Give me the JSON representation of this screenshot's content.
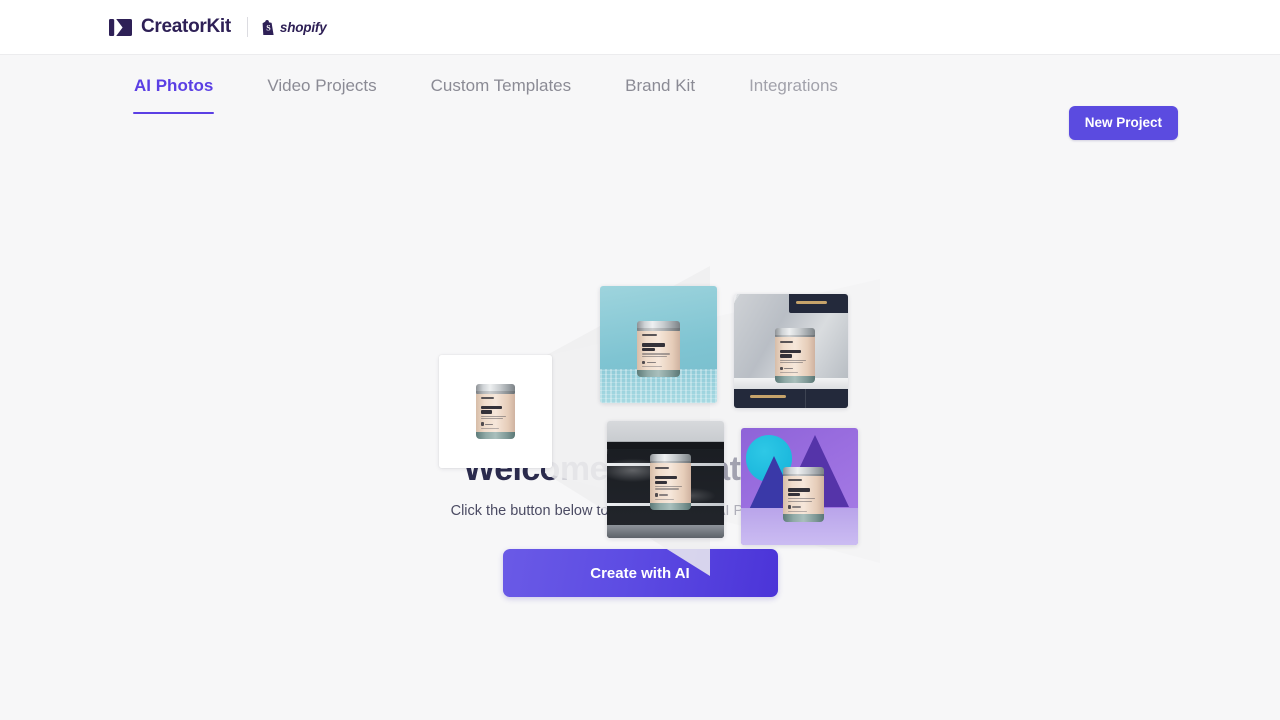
{
  "header": {
    "brand_name": "CreatorKit",
    "brand_icon": "video-play-icon",
    "partner": {
      "icon": "shopify-bag-icon",
      "label": "shopify"
    }
  },
  "nav": {
    "tabs": [
      {
        "label": "AI Photos",
        "active": true
      },
      {
        "label": "Video Projects",
        "active": false
      },
      {
        "label": "Custom Templates",
        "active": false
      },
      {
        "label": "Brand Kit",
        "active": false
      },
      {
        "label": "Integrations",
        "active": false
      }
    ],
    "new_project_label": "New Project"
  },
  "hero": {
    "source_image_alt": "UTILITY BAR product jar on plain white background",
    "generated_variants": [
      {
        "scene": "teal-studio-backdrop",
        "alt": "UTILITY BAR jar on teal backdrop with tiled floor"
      },
      {
        "scene": "marble-kitchen-counter",
        "alt": "UTILITY BAR jar on marble counter with navy cabinets"
      },
      {
        "scene": "dark-stone-shelf",
        "alt": "UTILITY BAR jar on dark marble shelf"
      },
      {
        "scene": "purple-geometric-set",
        "alt": "UTILITY BAR jar on purple set with cyan circle and triangles"
      }
    ],
    "product_label": {
      "brand": "CreatorKit",
      "title_line_1": "UTILITY",
      "title_line_2": "BAR"
    }
  },
  "main": {
    "headline": "Welcome to CreatorKit",
    "subhead": "Click the button below to create your first AI Product Photo.",
    "cta_label": "Create with AI"
  },
  "colors": {
    "brand_purple": "#5b3fe4",
    "button_purple": "#5b4be0",
    "cta_gradient_start": "#6a5ae6",
    "cta_gradient_end": "#4b34d8",
    "heading_navy": "#2b2b4d",
    "brand_navy": "#2e2056",
    "page_background": "#f7f7f8",
    "header_background": "#ffffff",
    "tab_inactive": "#8b8b95"
  }
}
